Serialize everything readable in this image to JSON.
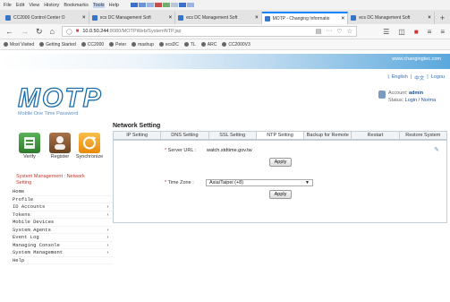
{
  "menubar": {
    "items": [
      "File",
      "Edit",
      "View",
      "History",
      "Bookmarks",
      "Tools",
      "Help"
    ],
    "highlighted_index": 5
  },
  "tabs": [
    {
      "title": "CC2000 Control Center O",
      "active": false
    },
    {
      "title": "ecs DC Management Soft",
      "active": false
    },
    {
      "title": "ecs DC Management Soft",
      "active": false
    },
    {
      "title": "MOTP - Changing Informatio",
      "active": true
    },
    {
      "title": "ecs DC Management Soft",
      "active": false
    }
  ],
  "url": {
    "host": "10.0.50.244",
    "path": ":8080/MOTPWeb/SystemNTP.jsp"
  },
  "bookmarks": [
    "Most Visited",
    "Getting Started",
    "CC2000",
    "Peter",
    "mashup",
    "ecsDC",
    "TL",
    "ARC",
    "CC2000V3"
  ],
  "site_url": "www.changingtec.com",
  "logo": {
    "text": "MOTP",
    "subtitle": "Mobile One Time Password"
  },
  "language": {
    "english": "English",
    "chinese": "中文",
    "logout": "Logou"
  },
  "account": {
    "label": "Account:",
    "value": "admin",
    "status_label": "Status:",
    "status_value": "Login / Norma"
  },
  "actions": [
    {
      "label": "Verify",
      "icon": "verify-icon",
      "color": "#3f8f3a"
    },
    {
      "label": "Register",
      "icon": "register-icon",
      "color": "#8a5a2b"
    },
    {
      "label": "Synchronize",
      "icon": "synchronize-icon",
      "color": "#f0a11c"
    }
  ],
  "breadcrumb": {
    "section": "System Management",
    "separator": ":",
    "page": "Network Setting"
  },
  "menu": [
    {
      "label": "Home",
      "arrow": false
    },
    {
      "label": "Profile",
      "arrow": false
    },
    {
      "label": "ID Accounts",
      "arrow": true
    },
    {
      "label": "Tokens",
      "arrow": true
    },
    {
      "label": "Mobile Devices",
      "arrow": false
    },
    {
      "label": "System Agents",
      "arrow": true
    },
    {
      "label": "Event Log",
      "arrow": true
    },
    {
      "label": "Managing Console",
      "arrow": true
    },
    {
      "label": "System Management",
      "arrow": true
    },
    {
      "label": "Help",
      "arrow": false
    }
  ],
  "network_setting": {
    "title": "Network Setting",
    "tabs": [
      "IP Setting",
      "DNS Setting",
      "SSL Setting",
      "NTP Setting",
      "Backup for Remote",
      "Restart",
      "Restore System"
    ],
    "active_tab": 3,
    "server_url_label": "Server URL :",
    "server_url_value": "watch.stdtime.gov.tw",
    "apply_label": "Apply",
    "timezone_label": "Time Zone :",
    "timezone_value": "Asia/Taipei (+8)",
    "apply2_label": "Apply"
  },
  "colors": {
    "accent": "#1b6ca9",
    "strip": "#5aa8dd",
    "red": "#c0392b"
  }
}
